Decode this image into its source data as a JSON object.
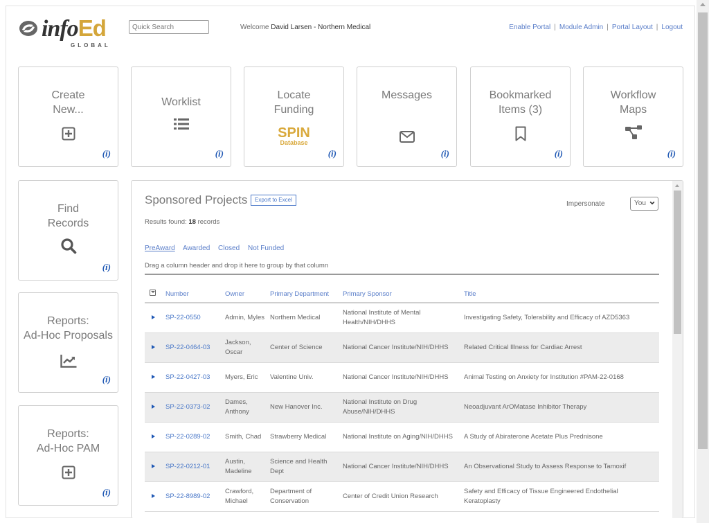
{
  "header": {
    "logo": {
      "brand_main": "info",
      "brand_accent": "Ed",
      "brand_sub": "GLOBAL"
    },
    "quick_search": {
      "placeholder": "Quick Search",
      "value": ""
    },
    "welcome_prefix": "Welcome ",
    "welcome_user": "David Larsen - Northern Medical",
    "links": [
      {
        "label": "Enable Portal"
      },
      {
        "label": "Module Admin"
      },
      {
        "label": "Portal Layout"
      },
      {
        "label": "Logout"
      }
    ],
    "separator": "|"
  },
  "tiles": [
    {
      "id": "create-new",
      "line1": "Create",
      "line2": "New...",
      "icon": "plus-square-icon",
      "info": "(i)"
    },
    {
      "id": "worklist",
      "line1": "Worklist",
      "line2": "",
      "icon": "list-icon",
      "info": "(i)"
    },
    {
      "id": "locate-funding",
      "line1": "Locate",
      "line2": "Funding",
      "icon": "spin-database-logo",
      "icon_text1": "SPIN",
      "icon_text2": "Database",
      "info": "(i)"
    },
    {
      "id": "messages",
      "line1": "Messages",
      "line2": "",
      "icon": "envelope-icon",
      "info": "(i)"
    },
    {
      "id": "bookmarked-items",
      "line1": "Bookmarked",
      "line2": "Items (3)",
      "icon": "bookmark-icon",
      "info": "(i)"
    },
    {
      "id": "workflow-maps",
      "line1": "Workflow",
      "line2": "Maps",
      "icon": "workflow-icon",
      "info": "(i)"
    },
    {
      "id": "find-records",
      "line1": "Find",
      "line2": "Records",
      "icon": "search-icon",
      "info": "(i)"
    },
    {
      "id": "reports-adhoc-proposals",
      "line1": "Reports:",
      "line2": "Ad-Hoc Proposals",
      "icon": "chart-line-icon",
      "info": "(i)"
    },
    {
      "id": "reports-adhoc-pam",
      "line1": "Reports:",
      "line2": "Ad-Hoc PAM",
      "icon": "plus-square-icon",
      "info": "(i)"
    }
  ],
  "projects": {
    "title": "Sponsored Projects",
    "export_label": "Export to Excel",
    "results_prefix": "Results found: ",
    "results_count": "18",
    "results_suffix": " records",
    "impersonate_label": "Impersonate",
    "impersonate_value": "You",
    "filter_tabs": [
      {
        "label": "PreAward",
        "active": true
      },
      {
        "label": "Awarded",
        "active": false
      },
      {
        "label": "Closed",
        "active": false
      },
      {
        "label": "Not Funded",
        "active": false
      }
    ],
    "group_hint": "Drag a column header and drop it here to group by that column",
    "columns": [
      "Number",
      "Owner",
      "Primary Department",
      "Primary Sponsor",
      "Title"
    ],
    "rows": [
      {
        "number": "SP-22-0550",
        "owner": "Admin, Myles",
        "department": "Northern Medical",
        "sponsor": "National Institute of Mental Health/NIH/DHHS",
        "title": "Investigating Safety, Tolerability and Efficacy of AZD5363"
      },
      {
        "number": "SP-22-0464-03",
        "owner": "Jackson, Oscar",
        "department": "Center of Science",
        "sponsor": "National Cancer Institute/NIH/DHHS",
        "title": "Related Critical Illness for Cardiac Arrest"
      },
      {
        "number": "SP-22-0427-03",
        "owner": "Myers, Eric",
        "department": "Valentine Univ.",
        "sponsor": "National Cancer Institute/NIH/DHHS",
        "title": "Animal Testing on Anxiety for Institution #PAM-22-0168"
      },
      {
        "number": "SP-22-0373-02",
        "owner": "Dames, Anthony",
        "department": "New Hanover Inc.",
        "sponsor": "National Institute on Drug Abuse/NIH/DHHS",
        "title": "Neoadjuvant ArOMatase Inhibitor Therapy"
      },
      {
        "number": "SP-22-0289-02",
        "owner": "Smith, Chad",
        "department": "Strawberry Medical",
        "sponsor": "National Institute on Aging/NIH/DHHS",
        "title": "A Study of Abiraterone Acetate Plus Prednisone"
      },
      {
        "number": "SP-22-0212-01",
        "owner": "Austin, Madeline",
        "department": "Science and Health Dept",
        "sponsor": "National Cancer Institute/NIH/DHHS",
        "title": "An Observational Study to Assess Response to Tamoxif"
      },
      {
        "number": "SP-22-8989-02",
        "owner": "Crawford, Michael",
        "department": "Department of Conservation",
        "sponsor": "Center of Credit Union Research",
        "title": "Safety and Efficacy of Tissue Engineered Endothelial Keratoplasty"
      }
    ]
  },
  "colors": {
    "link": "#5a7ec9",
    "info": "#1f58b4",
    "brand_gold": "#d4a63a",
    "row_alt": "#ececec"
  }
}
